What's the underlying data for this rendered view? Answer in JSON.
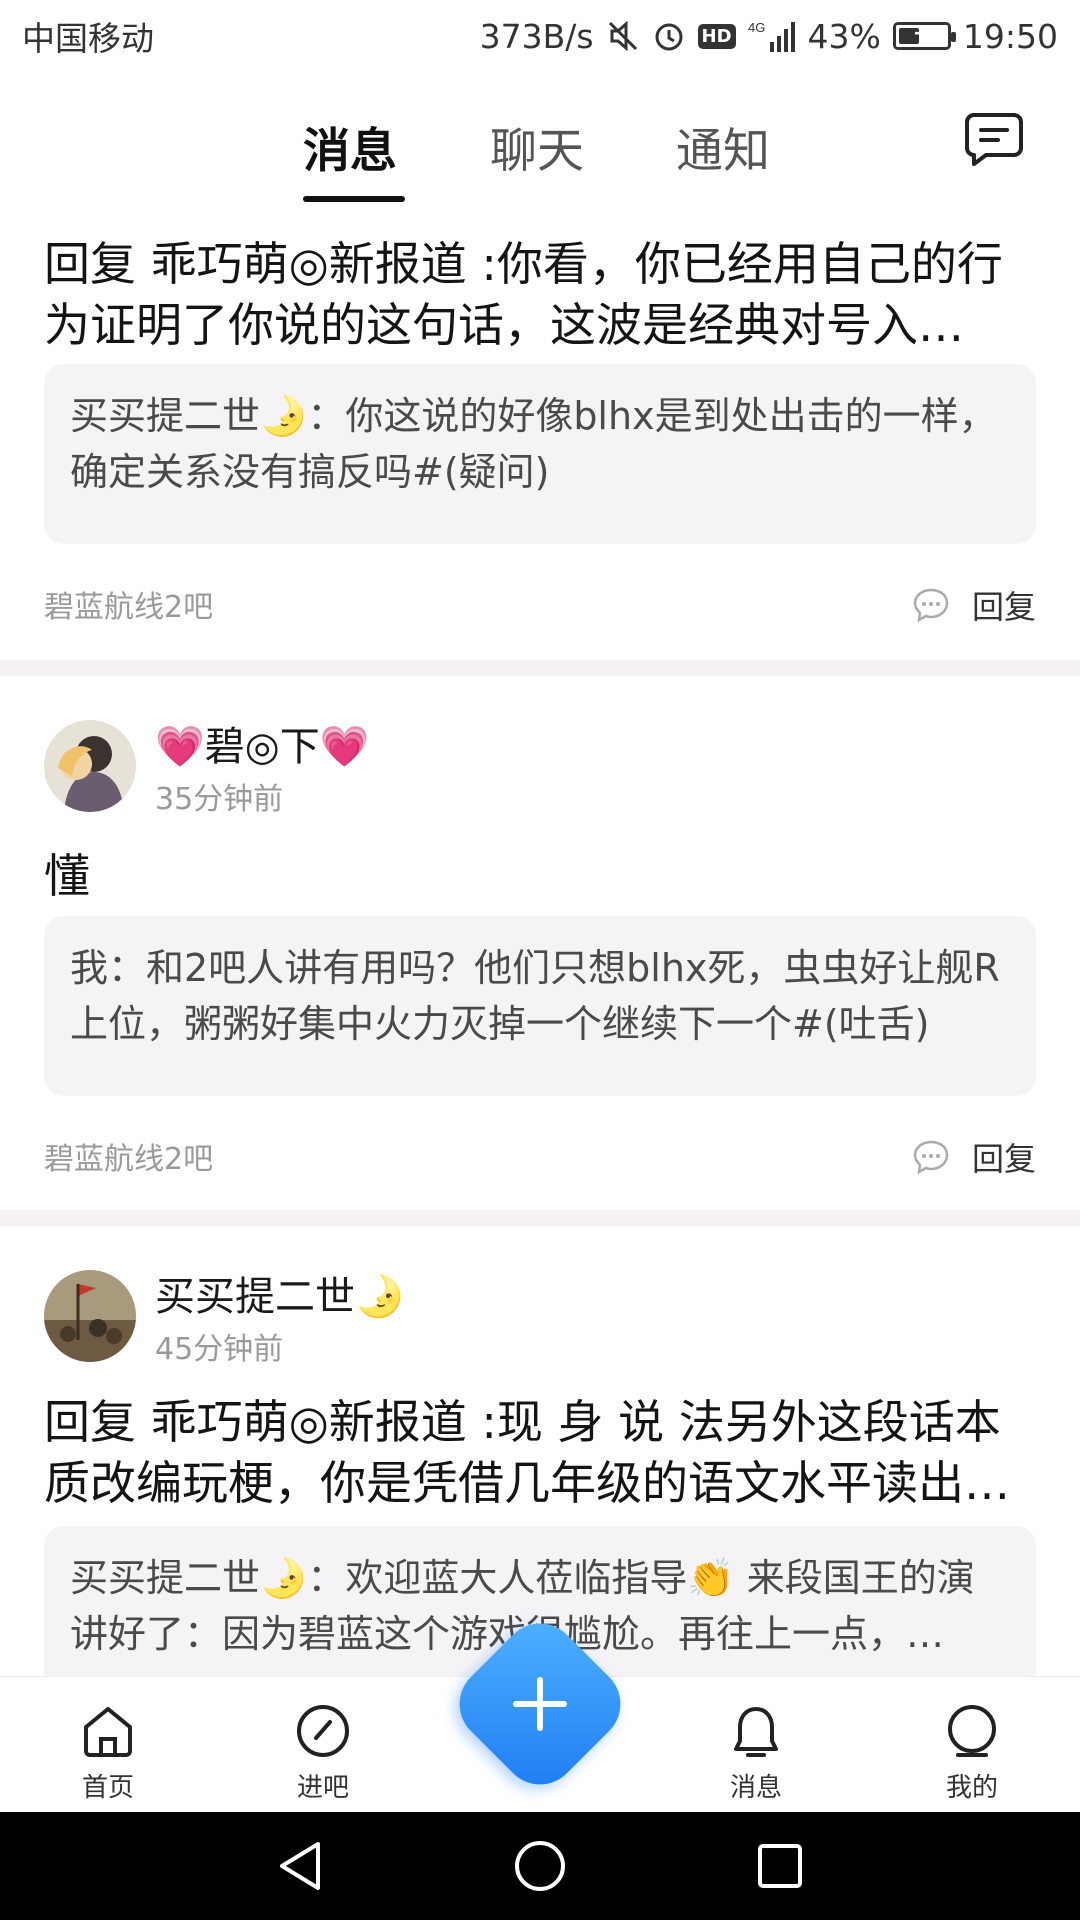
{
  "status_bar": {
    "carrier": "中国移动",
    "net_speed": "373B/s",
    "network": "4G",
    "hd": "HD",
    "battery_pct": "43%",
    "battery_level": 0.43,
    "time": "19:50"
  },
  "tabs": [
    {
      "label": "消息",
      "active": true
    },
    {
      "label": "聊天",
      "active": false
    },
    {
      "label": "通知",
      "active": false
    }
  ],
  "feed": [
    {
      "title": "回复 乖巧萌◎新报道 :你看，你已经用自己的行为证明了你说的这句话，这波是经典对号入…",
      "quote": "买买提二世🌛：你这说的好像blhx是到处出击的一样，确定关系没有搞反吗#(疑问)",
      "forum": "碧蓝航线2吧",
      "reply_label": "回复"
    },
    {
      "username": "💗碧◎下💗",
      "time": "35分钟前",
      "text": "懂",
      "quote": "我：和2吧人讲有用吗？他们只想blhx死，虫虫好让舰R上位，粥粥好集中火力灭掉一个继续下一个#(吐舌)",
      "forum": "碧蓝航线2吧",
      "reply_label": "回复"
    },
    {
      "username": "买买提二世🌛",
      "time": "45分钟前",
      "title": "回复 乖巧萌◎新报道 :现 身 说 法另外这段话本质改编玩梗，你是凭借几年级的语文水平读出…",
      "quote": "买买提二世🌛：欢迎蓝大人莅临指导👏 来段国王的演讲好了：因为碧蓝这个游戏很尴尬。再往上一点，…"
    }
  ],
  "bottom_nav": [
    {
      "label": "首页",
      "icon": "home-icon"
    },
    {
      "label": "进吧",
      "icon": "compass-icon"
    },
    {
      "label": "消息",
      "icon": "bell-icon"
    },
    {
      "label": "我的",
      "icon": "profile-icon"
    }
  ],
  "fab_icon": "plus-icon",
  "colors": {
    "fab_start": "#4fb3ff",
    "fab_end": "#1e7bf2",
    "divider": "#f6f1f4",
    "quote_bg": "#f5f3f6"
  }
}
